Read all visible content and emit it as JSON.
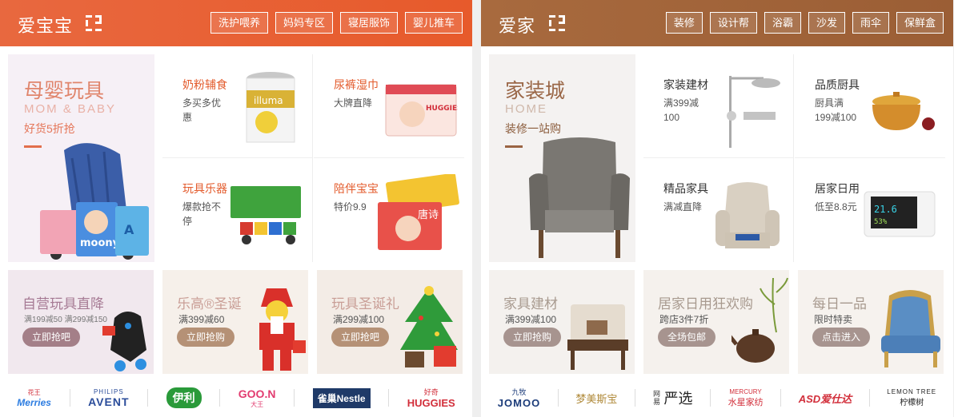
{
  "colors": {
    "left_header": "#e8683f",
    "right_header": "#a06338",
    "accent_left": "#e35b2c",
    "button_left": "#a47f88",
    "button_brown": "#b59176",
    "button_grey": "#a7948f"
  },
  "left": {
    "title": "爱宝宝",
    "tags": [
      "洗护喂养",
      "妈妈专区",
      "寝居服饰",
      "婴儿推车"
    ],
    "big": {
      "title": "母婴玩具",
      "en": "MOM & BABY",
      "sub": "好货5折抢"
    },
    "cells": [
      {
        "title": "奶粉辅食",
        "desc": "多买多优惠"
      },
      {
        "title": "尿裤湿巾",
        "desc": "大牌直降"
      },
      {
        "title": "玩具乐器",
        "desc": "爆款抢不停"
      },
      {
        "title": "陪伴宝宝",
        "desc": "特价9.9"
      }
    ],
    "bottom": [
      {
        "title": "自营玩具直降",
        "desc": "满199减50 满299减150",
        "btn": "立即抢吧"
      },
      {
        "title": "乐高®圣诞",
        "desc": "满399减60",
        "btn": "立即抢购"
      },
      {
        "title": "玩具圣诞礼",
        "desc": "满299减100",
        "btn": "立即抢吧"
      }
    ],
    "brands": {
      "merries_top": "花王",
      "merries": "Merries",
      "avent_top": "PHILIPS",
      "avent": "AVENT",
      "yili": "伊利",
      "goon": "GOO.N",
      "goon_sub": "大王",
      "nestle": "雀巢Nestle",
      "huggies_top": "好奇",
      "huggies": "HUGGIES"
    }
  },
  "right": {
    "title": "爱家",
    "tags": [
      "装修",
      "设计帮",
      "浴霸",
      "沙发",
      "雨伞",
      "保鲜盒"
    ],
    "big": {
      "title": "家装城",
      "en": "HOME",
      "sub": "装修一站购"
    },
    "cells": [
      {
        "title": "家装建材",
        "desc": "满399减100"
      },
      {
        "title": "品质厨具",
        "desc": "厨具满199减100"
      },
      {
        "title": "精品家具",
        "desc": "满减直降"
      },
      {
        "title": "居家日用",
        "desc": "低至8.8元"
      }
    ],
    "bottom": [
      {
        "title": "家具建材",
        "desc": "满399减100",
        "btn": "立即抢购"
      },
      {
        "title": "居家日用狂欢购",
        "desc": "跨店3件7折",
        "btn": "全场包邮"
      },
      {
        "title": "每日一品",
        "desc": "限时特卖",
        "btn": "点击进入"
      }
    ],
    "brands": {
      "jomoo_top": "九牧",
      "jomoo": "JOMOO",
      "mengjie": "梦美斯宝",
      "yanxuan_pre": "网易",
      "yanxuan": "严选",
      "mercury": "水星家纺",
      "mercury_en": "MERCURY",
      "asd": "ASD爱仕达",
      "lemon_en": "LEMON TREE",
      "lemon": "柠檬树"
    }
  }
}
